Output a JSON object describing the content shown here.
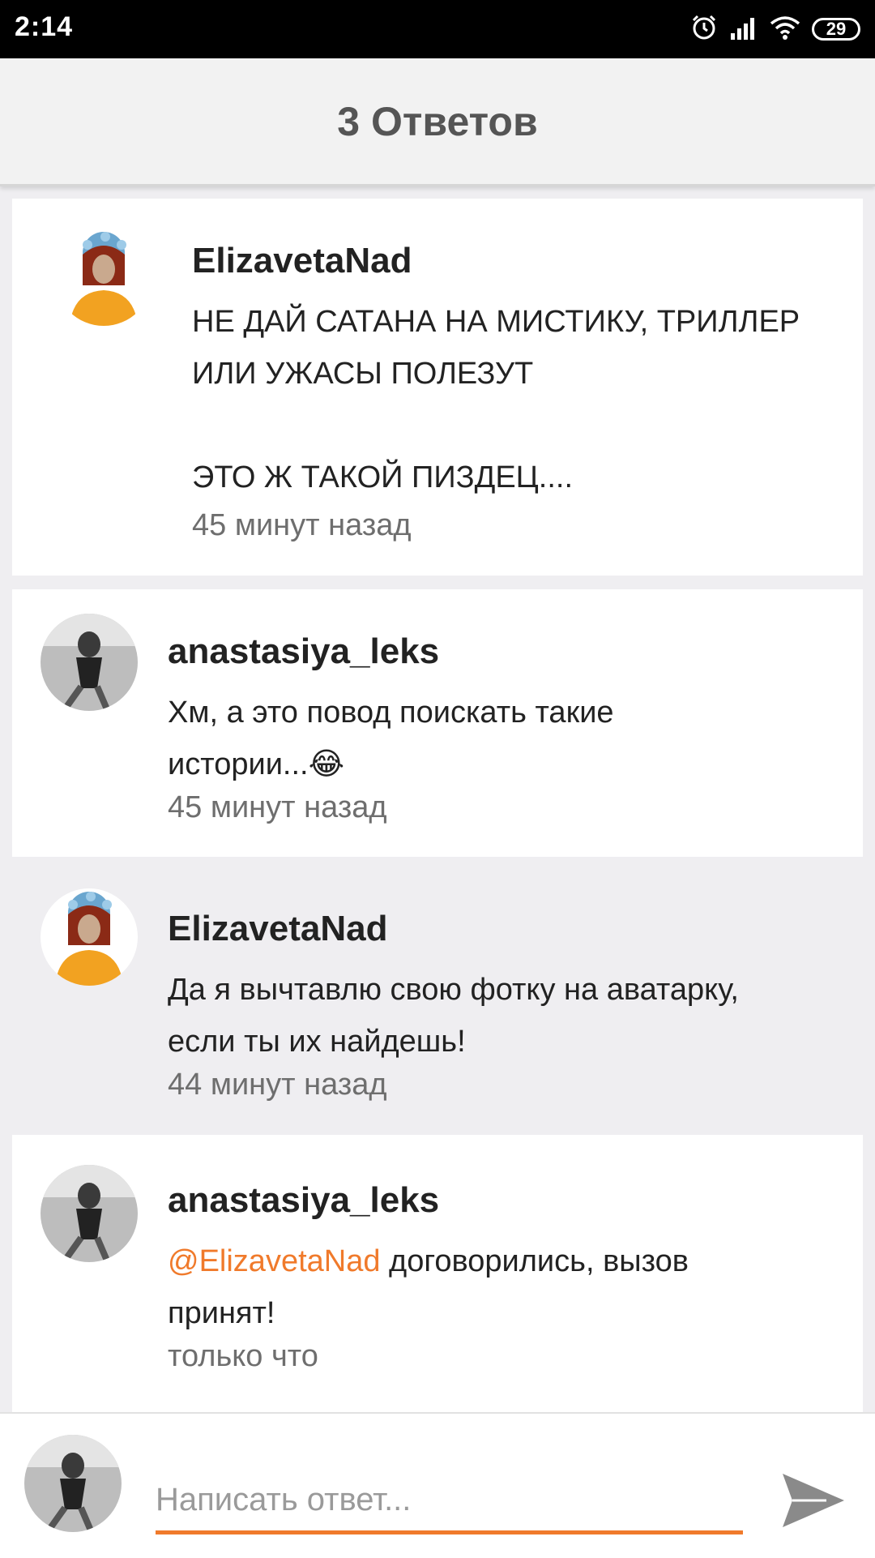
{
  "status_bar": {
    "time": "2:14",
    "battery": "29"
  },
  "header": {
    "title": "3 Ответов"
  },
  "comments": [
    {
      "username": "ElizavetaNad",
      "text_lines": [
        "НЕ ДАЙ САТАНА НА МИСТИКУ, ТРИЛЛЕР",
        "ИЛИ УЖАСЫ ПОЛЕЗУТ",
        "",
        "ЭТО Ж ТАКОЙ ПИЗДЕЦ...."
      ],
      "time": "45 минут назад"
    },
    {
      "username": "anastasiya_leks",
      "text_lines": [
        "Хм, а это повод поискать такие",
        "истории...😂"
      ],
      "time": "45 минут назад"
    },
    {
      "username": "ElizavetaNad",
      "text_lines": [
        "Да я вычтавлю свою фотку на аватарку,",
        "если ты их найдешь!"
      ],
      "time": "44 минут назад"
    },
    {
      "username": "anastasiya_leks",
      "mention": "@ElizavetaNad",
      "text_after_mention": " договорились, вызов",
      "text_line2": "принят!",
      "time": "только что"
    }
  ],
  "reply": {
    "placeholder": "Написать ответ..."
  },
  "colors": {
    "accent": "#f07a2b",
    "background": "#efeef1",
    "card": "#ffffff"
  },
  "icons": [
    "alarm-icon",
    "signal-icon",
    "wifi-icon",
    "battery-icon",
    "send-icon"
  ]
}
